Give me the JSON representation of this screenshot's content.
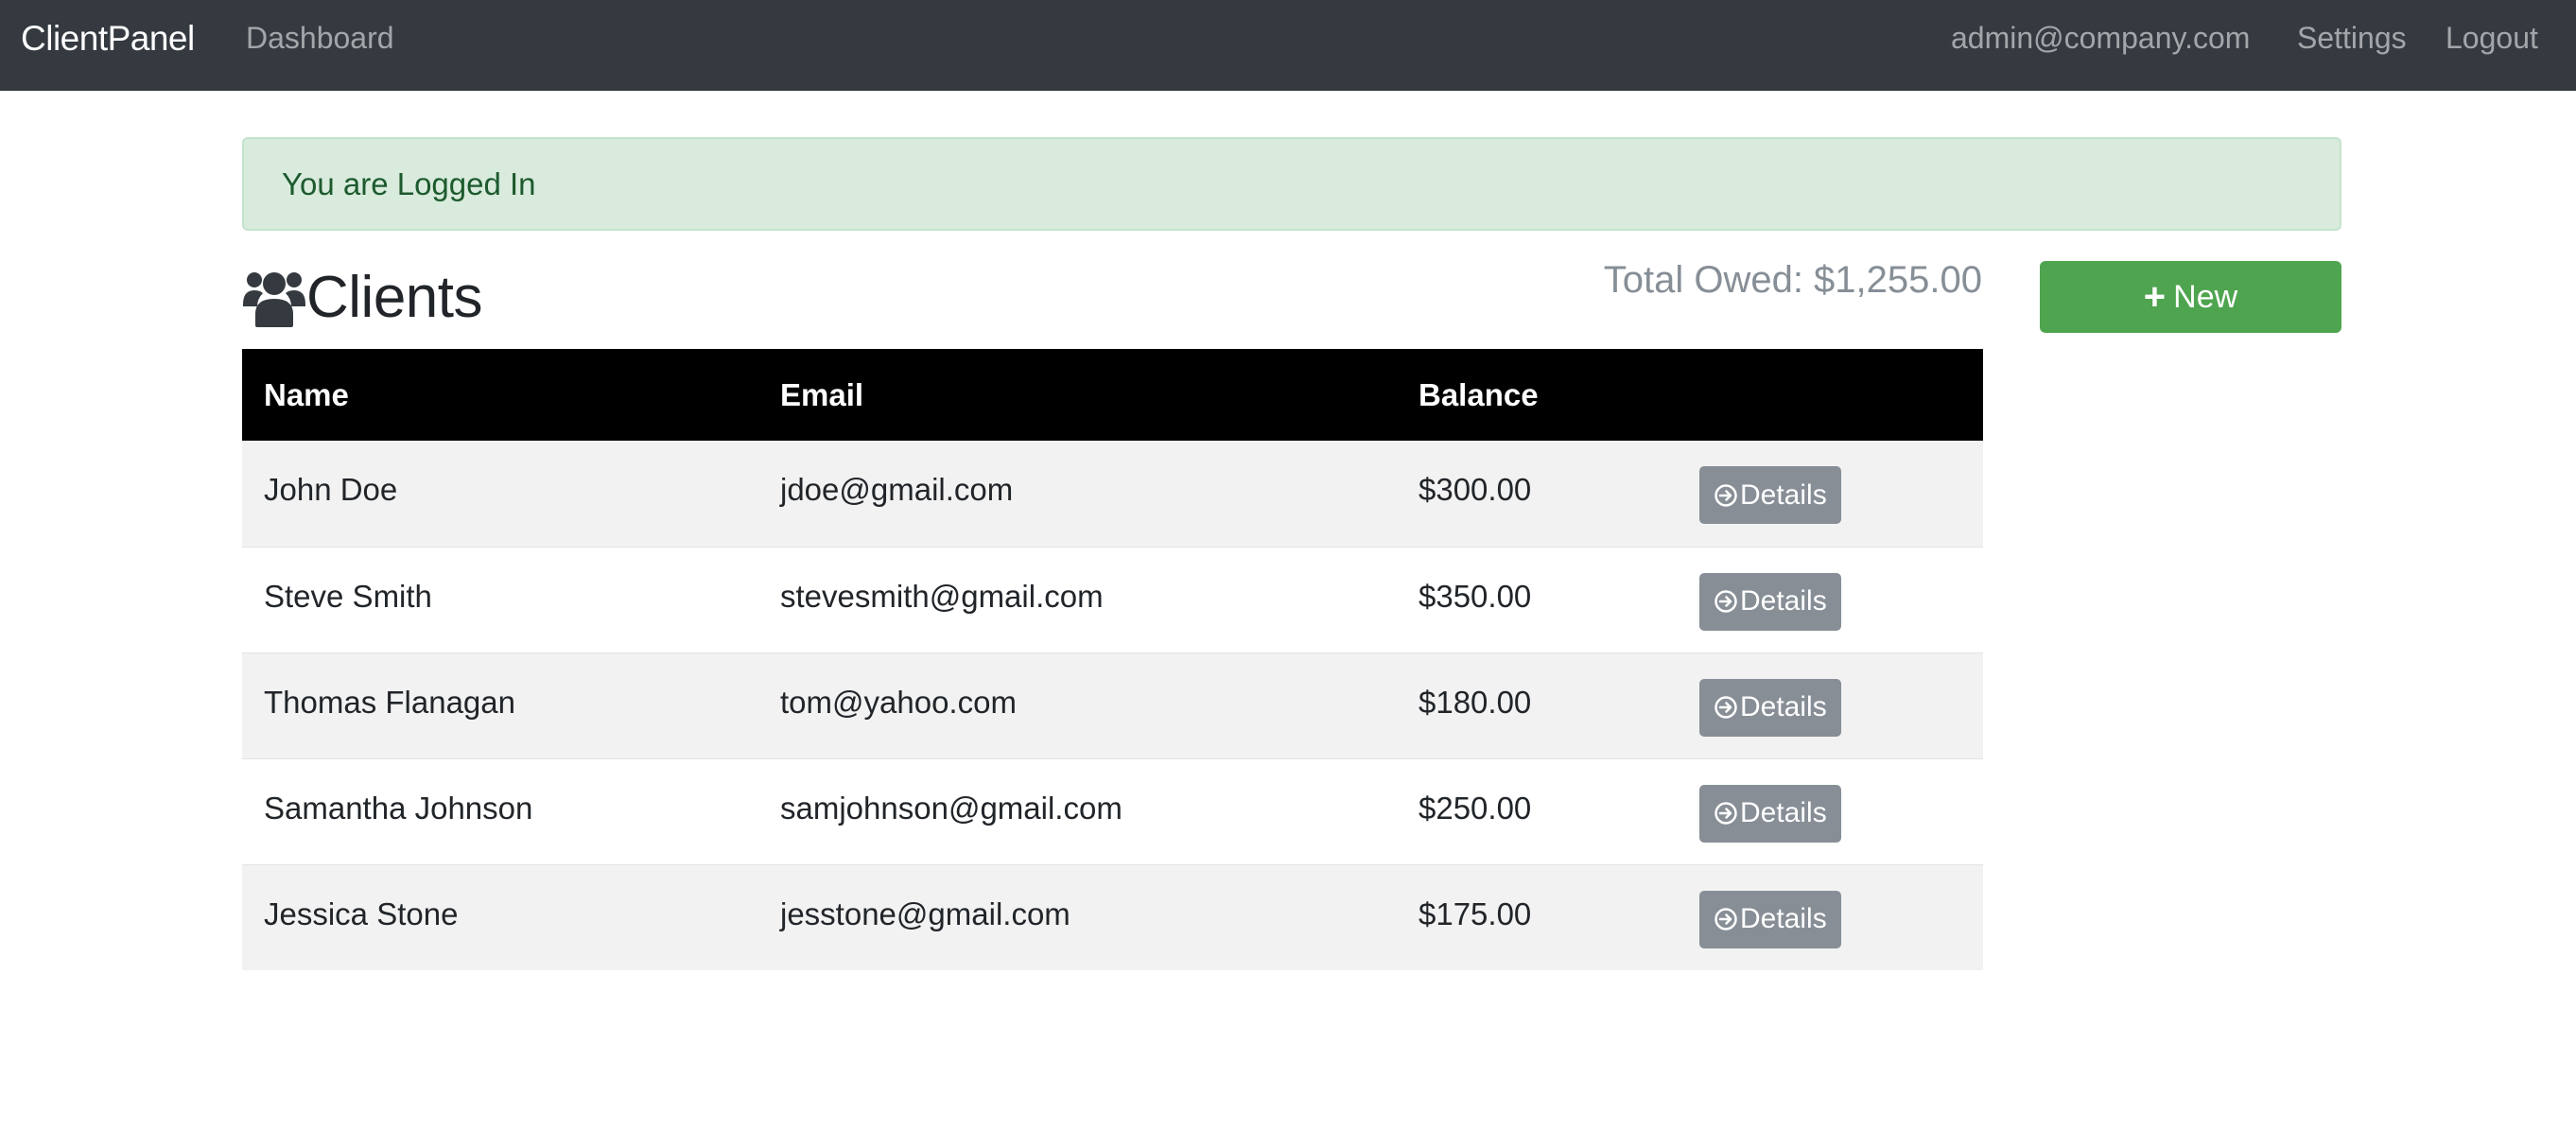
{
  "nav": {
    "brand": "ClientPanel",
    "dashboard": "Dashboard",
    "email": "admin@company.com",
    "settings": "Settings",
    "logout": "Logout"
  },
  "alert": {
    "message": "You are Logged In"
  },
  "clients_header": {
    "title": "Clients",
    "icon": "users-icon",
    "total_owed": "Total Owed: $1,255.00",
    "new_label": "New"
  },
  "table": {
    "headers": {
      "name": "Name",
      "email": "Email",
      "balance": "Balance"
    },
    "details_label": "Details",
    "rows": [
      {
        "name": "John Doe",
        "email": "jdoe@gmail.com",
        "balance": "$300.00"
      },
      {
        "name": "Steve Smith",
        "email": "stevesmith@gmail.com",
        "balance": "$350.00"
      },
      {
        "name": "Thomas Flanagan",
        "email": "tom@yahoo.com",
        "balance": "$180.00"
      },
      {
        "name": "Samantha Johnson",
        "email": "samjohnson@gmail.com",
        "balance": "$250.00"
      },
      {
        "name": "Jessica Stone",
        "email": "jesstone@gmail.com",
        "balance": "$175.00"
      }
    ]
  },
  "colors": {
    "navbar": "#343a40",
    "alert_bg": "#d8ebdc",
    "new_button": "#4ea44f",
    "details_button": "#878e96",
    "table_header": "#000000"
  }
}
